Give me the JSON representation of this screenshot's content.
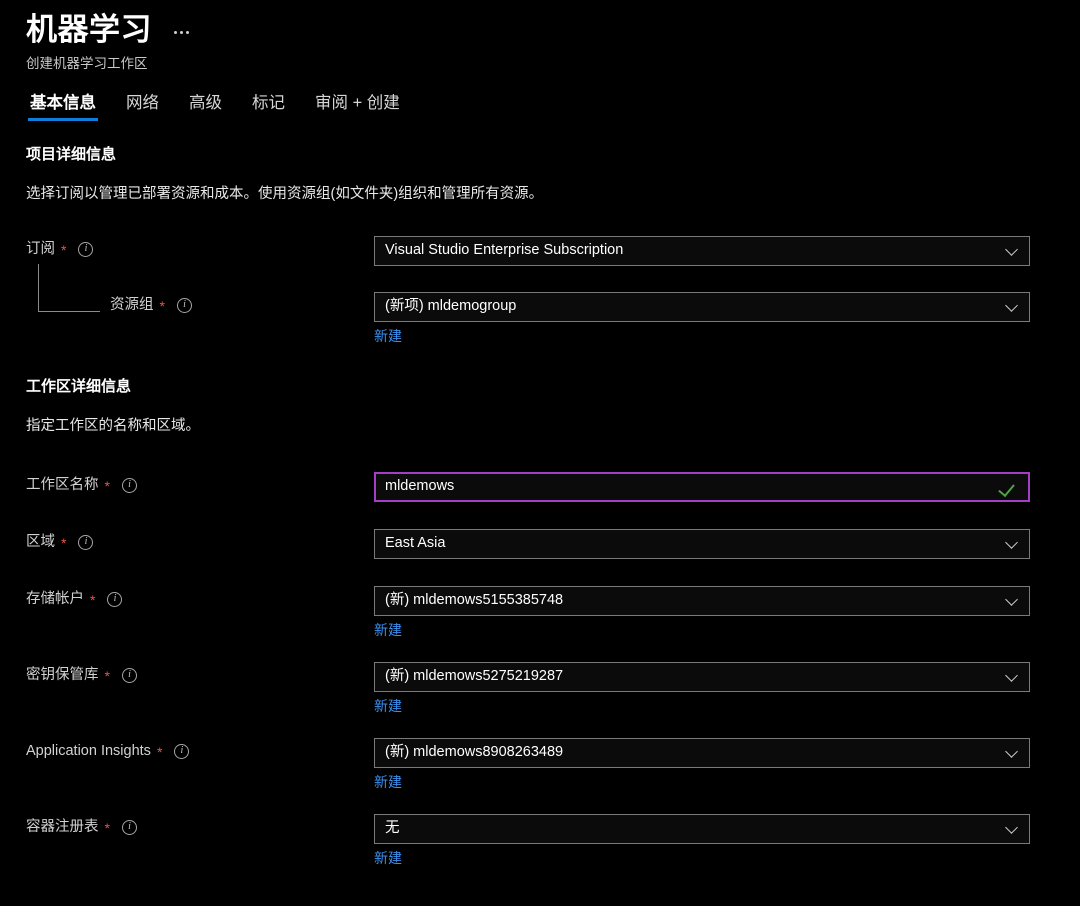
{
  "header": {
    "title": "机器学习",
    "more_menu": "...",
    "subtitle": "创建机器学习工作区"
  },
  "tabs": [
    {
      "label": "基本信息",
      "active": true
    },
    {
      "label": "网络",
      "active": false
    },
    {
      "label": "高级",
      "active": false
    },
    {
      "label": "标记",
      "active": false
    },
    {
      "label": "审阅 + 创建",
      "active": false
    }
  ],
  "sections": [
    {
      "title": "项目详细信息",
      "description": "选择订阅以管理已部署资源和成本。使用资源组(如文件夹)组织和管理所有资源。"
    },
    {
      "title": "工作区详细信息",
      "description": "指定工作区的名称和区域。"
    }
  ],
  "fields": {
    "subscription": {
      "label": "订阅",
      "required": "*",
      "info": "i",
      "value": "Visual Studio Enterprise Subscription"
    },
    "resource_group": {
      "label": "资源组",
      "required": "*",
      "info": "i",
      "value": "(新项) mldemogroup",
      "create_new": "新建"
    },
    "workspace_name": {
      "label": "工作区名称",
      "required": "*",
      "info": "i",
      "value": "mldemows",
      "placeholder": "工作区名称"
    },
    "region": {
      "label": "区域",
      "required": "*",
      "info": "i",
      "value": "East Asia"
    },
    "storage_account": {
      "label": "存储帐户",
      "required": "*",
      "info": "i",
      "value": "(新) mldemows5155385748",
      "create_new": "新建"
    },
    "key_vault": {
      "label": "密钥保管库",
      "required": "*",
      "info": "i",
      "value": "(新) mldemows5275219287",
      "create_new": "新建"
    },
    "application_insights": {
      "label": "Application Insights",
      "required": "*",
      "info": "i",
      "value": "(新) mldemows8908263489",
      "create_new": "新建"
    },
    "container_registry": {
      "label": "容器注册表",
      "required": "*",
      "info": "i",
      "value": "无",
      "create_new": "新建"
    }
  },
  "colors": {
    "background": "#000000",
    "accent_blue": "#0f7ddb",
    "link_blue": "#3b8eea",
    "required_red": "#e8554a",
    "focus_purple": "#a33fc2",
    "valid_green": "#51a245"
  }
}
